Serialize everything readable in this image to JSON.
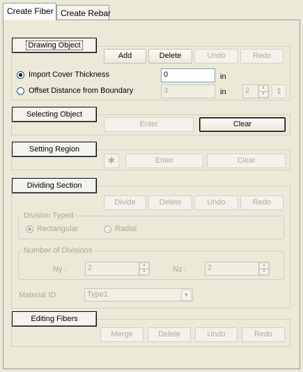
{
  "tabs": [
    "Create Fiber",
    "Create Rebar"
  ],
  "drawing": {
    "title": "Drawing Object",
    "add": "Add",
    "delete": "Delete",
    "undo": "Undo",
    "redo": "Redo",
    "import_cover": "Import Cover Thickness",
    "import_value": "0",
    "offset": "Offset Distance from Boundary",
    "offset_value": "3",
    "unit": "in",
    "offset_count": "2"
  },
  "selecting": {
    "title": "Selecting Object",
    "enter": "Enter",
    "clear": "Clear"
  },
  "setting": {
    "title": "Setting Region",
    "enter": "Enter",
    "clear": "Clear"
  },
  "dividing": {
    "title": "Dividing Section",
    "divide": "Divide",
    "delete": "Delete",
    "undo": "Undo",
    "redo": "Redo",
    "division_typed": "Division Typed",
    "rectangular": "Rectangular",
    "radial": "Radial",
    "num_divisions": "Number of Divisions",
    "ny_label": "Ny :",
    "ny_value": "2",
    "nz_label": "Nz :",
    "nz_value": "2",
    "material_label": "Material ID :",
    "material_value": "Type1"
  },
  "editing": {
    "title": "Editing Fibers",
    "merge": "Merge",
    "delete": "Delete",
    "undo": "Undo",
    "redo": "Redo"
  }
}
